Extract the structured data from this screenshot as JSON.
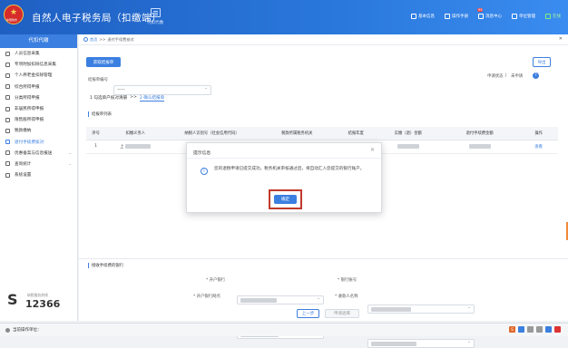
{
  "app": {
    "title": "自然人电子税务局（扣缴端）",
    "emblem_text": "中国税务",
    "top_tile_label": "代扣代缴"
  },
  "top_links": [
    {
      "label": "基本信息"
    },
    {
      "label": "操作手册"
    },
    {
      "label": "消息中心",
      "badge": "99"
    },
    {
      "label": "单位管理"
    },
    {
      "label": "在线"
    }
  ],
  "sidebar": {
    "header": "代扣代缴",
    "items": [
      {
        "label": "人员信息采集"
      },
      {
        "label": "专项附加扣除信息采集"
      },
      {
        "label": "个人养老金扣除管理"
      },
      {
        "label": "综合所得申报"
      },
      {
        "label": "分类所得申报"
      },
      {
        "label": "非居民所得申报"
      },
      {
        "label": "限售股所得申报"
      },
      {
        "label": "税款缴纳"
      },
      {
        "label": "退付手续费核对"
      },
      {
        "label": "优惠备案与信息报送"
      },
      {
        "label": "查询统计"
      },
      {
        "label": "系统设置"
      }
    ],
    "active_index": 8,
    "hotline_small": "纳税服务热线",
    "hotline_number": "12366"
  },
  "breadcrumb": {
    "home": "首页",
    "sep": ">>",
    "current": "退付手续费核对"
  },
  "main": {
    "get_report_btn": "获取结报单",
    "export_btn": "导出",
    "report_no_label": "结报单编号",
    "report_no_value": "——",
    "apply_status_label": "申请状态",
    "apply_status_value": "未申请",
    "steps": [
      "1 勾选单户核对清册",
      ">>",
      "2 确认结报单"
    ],
    "list_title": "结报单列表",
    "table_headers": [
      "序号",
      "扣缴义务人",
      "纳税人识别号（社会信用代码）",
      "税款所属税务机关",
      "结报年度",
      "实缴（退）金额",
      "退付手续费金额",
      "操作"
    ],
    "table_rows": [
      {
        "index": "1",
        "agent": "上",
        "taxid": "9",
        "action": "查看"
      }
    ],
    "bank_title": "接收手续费的银行",
    "bank_fields": {
      "open_bank": "* 开户银行",
      "account": "* 银行账号",
      "branch": "* 开户银行网点",
      "payee": "* 收款人名称"
    },
    "prev_btn": "上一步",
    "apply_btn": "申请退库"
  },
  "dialog": {
    "title": "提示信息",
    "message": "您的退税申请已提交成功，税务机关审核通过后，将自动汇入您提交的银行账户。",
    "confirm": "确定"
  },
  "status_bar": {
    "label": "当前操作单位："
  }
}
